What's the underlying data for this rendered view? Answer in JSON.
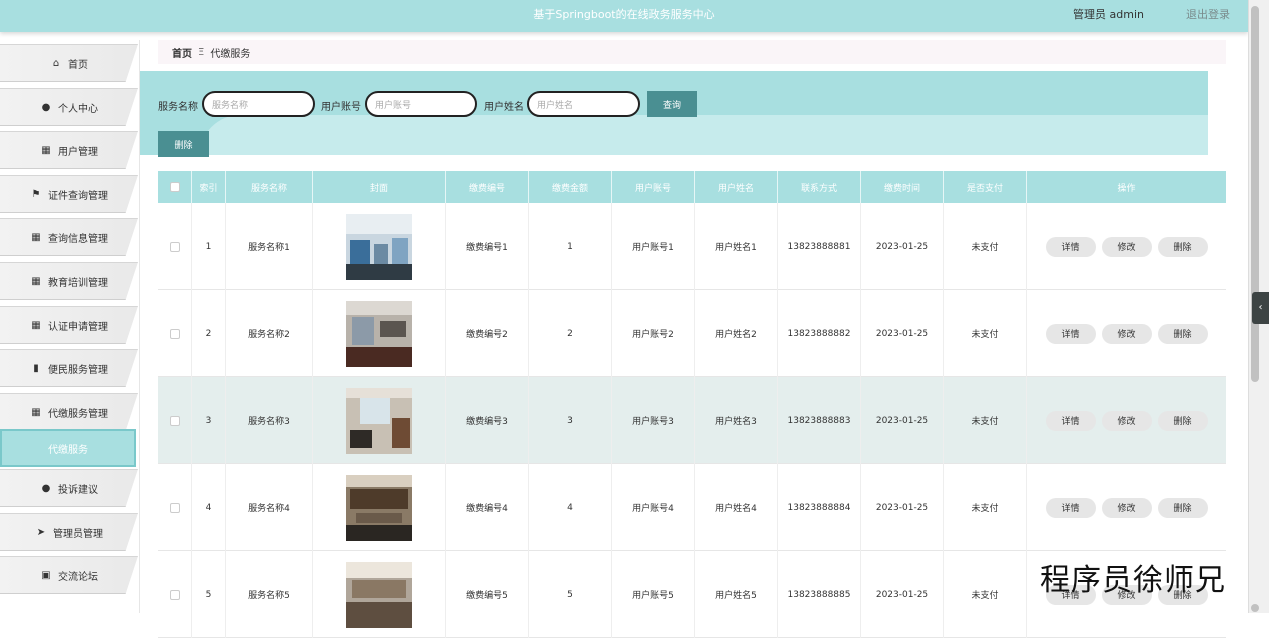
{
  "header": {
    "title": "基于Springboot的在线政务服务中心",
    "user": "管理员 admin",
    "logout": "退出登录"
  },
  "sidebar": {
    "items": [
      {
        "label": "首页",
        "icon": "home-icon"
      },
      {
        "label": "个人中心",
        "icon": "user-icon"
      },
      {
        "label": "用户管理",
        "icon": "grid-icon"
      },
      {
        "label": "证件查询管理",
        "icon": "flag-icon"
      },
      {
        "label": "查询信息管理",
        "icon": "grid-icon"
      },
      {
        "label": "教育培训管理",
        "icon": "grid-icon"
      },
      {
        "label": "认证申请管理",
        "icon": "grid-icon"
      },
      {
        "label": "便民服务管理",
        "icon": "bar-chart-icon"
      },
      {
        "label": "代缴服务管理",
        "icon": "grid-icon"
      },
      {
        "label": "代缴服务",
        "icon": ""
      },
      {
        "label": "投诉建议",
        "icon": "user-icon"
      },
      {
        "label": "管理员管理",
        "icon": "send-icon"
      },
      {
        "label": "交流论坛",
        "icon": "clipboard-icon"
      }
    ]
  },
  "breadcrumb": {
    "home": "首页",
    "separator": "Ξ",
    "current": "代缴服务"
  },
  "search": {
    "service_name_label": "服务名称",
    "service_name_placeholder": "服务名称",
    "account_label": "用户账号",
    "account_placeholder": "用户账号",
    "username_label": "用户姓名",
    "username_placeholder": "用户姓名",
    "query_button": "查询"
  },
  "toolbar": {
    "delete_button": "删除"
  },
  "table": {
    "headers": [
      "索引",
      "服务名称",
      "封面",
      "缴费编号",
      "缴费金额",
      "用户账号",
      "用户姓名",
      "联系方式",
      "缴费时间",
      "是否支付",
      "操作"
    ],
    "rows": [
      {
        "index": "1",
        "name": "服务名称1",
        "fee_no": "缴费编号1",
        "amount": "1",
        "account": "用户账号1",
        "username": "用户姓名1",
        "phone": "13823888881",
        "time": "2023-01-25",
        "paid": "未支付"
      },
      {
        "index": "2",
        "name": "服务名称2",
        "fee_no": "缴费编号2",
        "amount": "2",
        "account": "用户账号2",
        "username": "用户姓名2",
        "phone": "13823888882",
        "time": "2023-01-25",
        "paid": "未支付"
      },
      {
        "index": "3",
        "name": "服务名称3",
        "fee_no": "缴费编号3",
        "amount": "3",
        "account": "用户账号3",
        "username": "用户姓名3",
        "phone": "13823888883",
        "time": "2023-01-25",
        "paid": "未支付"
      },
      {
        "index": "4",
        "name": "服务名称4",
        "fee_no": "缴费编号4",
        "amount": "4",
        "account": "用户账号4",
        "username": "用户姓名4",
        "phone": "13823888884",
        "time": "2023-01-25",
        "paid": "未支付"
      },
      {
        "index": "5",
        "name": "服务名称5",
        "fee_no": "缴费编号5",
        "amount": "5",
        "account": "用户账号5",
        "username": "用户姓名5",
        "phone": "13823888885",
        "time": "2023-01-25",
        "paid": "未支付"
      }
    ],
    "actions": {
      "detail": "详情",
      "edit": "修改",
      "delete": "删除"
    }
  },
  "watermark": "程序员徐师兄",
  "colors": {
    "primary": "#a8dfe0",
    "button": "#4a8f92"
  }
}
